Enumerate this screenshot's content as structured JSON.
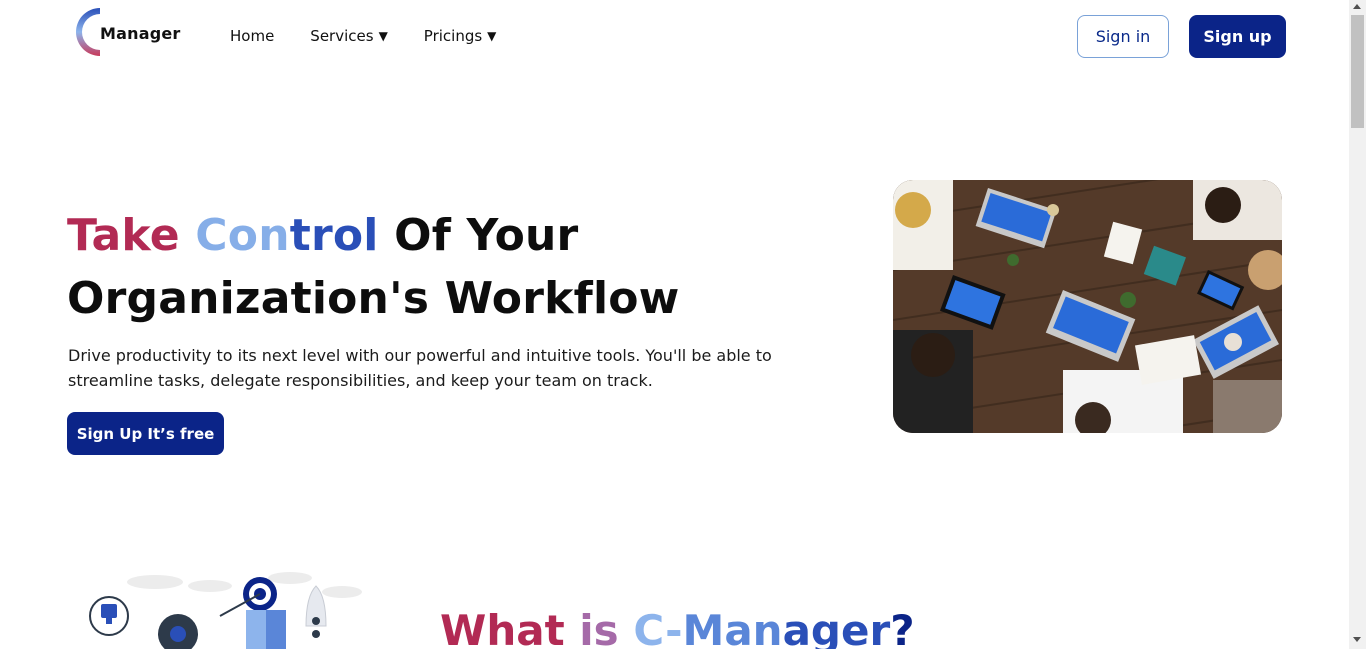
{
  "header": {
    "logo_text": "Manager",
    "nav": [
      {
        "label": "Home",
        "has_caret": false
      },
      {
        "label": "Services",
        "has_caret": true
      },
      {
        "label": "Pricings",
        "has_caret": true
      }
    ],
    "caret_glyph": "▼",
    "signin_label": "Sign in",
    "signup_label": "Sign up"
  },
  "hero": {
    "title_take": "Take ",
    "title_con": "Con",
    "title_trol": "trol",
    "title_rest": " Of Your Organization's Workflow",
    "description": "Drive productivity to its next level with our powerful and intuitive tools. You'll be able to streamline tasks, delegate responsibilities, and keep your team on track.",
    "cta_label": "Sign Up It’s free"
  },
  "section": {
    "title_what": "What ",
    "title_is": "is ",
    "title_c": "C-",
    "title_man": "Man",
    "title_ager": "ager",
    "title_q": "?"
  },
  "colors": {
    "primary": "#0b2488",
    "accent_red": "#b22a54",
    "accent_light_blue": "#86aee8",
    "accent_blue": "#2a4fb8"
  }
}
